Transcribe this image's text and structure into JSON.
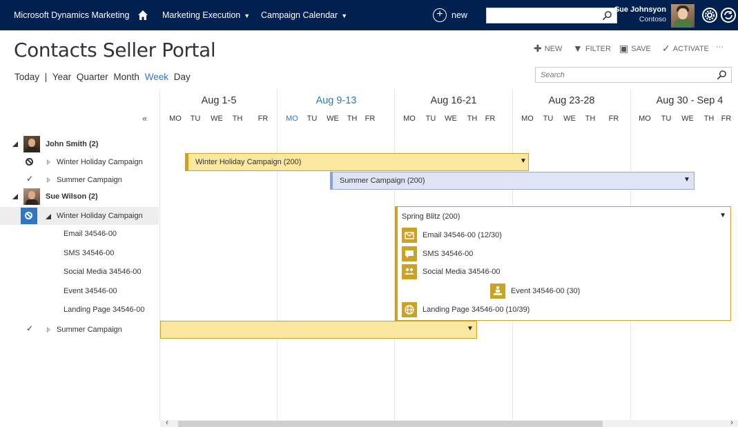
{
  "nav": {
    "app_title": "Microsoft Dynamics Marketing",
    "menu1": "Marketing Execution",
    "menu2": "Campaign Calendar",
    "new_label": "new",
    "search_placeholder": "",
    "user_name": "Sue Johnsyon",
    "user_org": "Contoso"
  },
  "page": {
    "title": "Contacts Seller Portal",
    "commands": {
      "new": "NEW",
      "filter": "FILTER",
      "save": "SAVE",
      "activate": "ACTIVATE",
      "more": "···"
    },
    "views": {
      "today": "Today",
      "sep": "|",
      "year": "Year",
      "quarter": "Quarter",
      "month": "Month",
      "week": "Week",
      "day": "Day"
    },
    "search_placeholder": "Search",
    "collapse_label": "«"
  },
  "calendar": {
    "weeks": [
      "Aug 1-5",
      "Aug 9-13",
      "Aug 16-21",
      "Aug 23-28",
      "Aug 30 - Sep 4"
    ],
    "days": [
      "MO",
      "TU",
      "WE",
      "TH",
      "FR"
    ],
    "current_week_index": 1
  },
  "tree": {
    "john": "John Smith (2)",
    "john_c1": "Winter Holiday Campaign",
    "john_c2": "Summer Campaign",
    "sue": "Sue Wilson (2)",
    "sue_c1": "Winter Holiday Campaign",
    "sue_a1": "Email 34546-00",
    "sue_a2": "SMS 34546-00",
    "sue_a3": "Social Media 34546-00",
    "sue_a4": "Event 34546-00",
    "sue_a5": "Landing Page 34546-00",
    "sue_c2": "Summer Campaign"
  },
  "bars": {
    "winter": "Winter Holiday Campaign (200)",
    "summer": "Summer Campaign (200)",
    "chevron": "⌄"
  },
  "blitz": {
    "title": "Spring Blitz (200)",
    "email": "Email 34546-00  (12/30)",
    "sms": "SMS 34546-00",
    "social": "Social Media 34546-00",
    "event": "Event 34546-00 (30)",
    "landing": "Landing Page 34546-00  (10/39)"
  },
  "colors": {
    "nav_bg": "#002050",
    "accent_blue": "#2f77c3",
    "campaign_gold": "#c9a227",
    "campaign_yellow": "#fae7a0",
    "campaign_blue": "#dfe4f5"
  }
}
